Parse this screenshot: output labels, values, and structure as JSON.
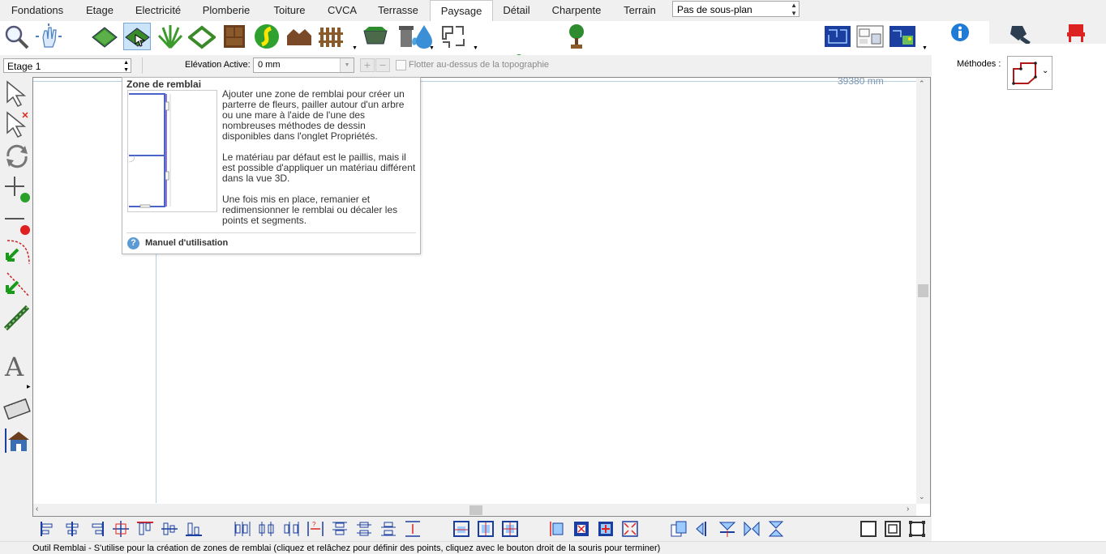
{
  "tabs": [
    {
      "label": "Fondations",
      "active": false
    },
    {
      "label": "Etage",
      "active": false
    },
    {
      "label": "Electricité",
      "active": false
    },
    {
      "label": "Plomberie",
      "active": false
    },
    {
      "label": "Toiture",
      "active": false
    },
    {
      "label": "CVCA",
      "active": false
    },
    {
      "label": "Terrasse",
      "active": false
    },
    {
      "label": "Paysage",
      "active": true
    },
    {
      "label": "Détail",
      "active": false
    },
    {
      "label": "Charpente",
      "active": false
    },
    {
      "label": "Terrain",
      "active": false
    }
  ],
  "subplan_select": {
    "value": "Pas de sous-plan"
  },
  "right_tabs": [
    "info-icon",
    "pen-nib-icon",
    "chair-icon"
  ],
  "toolbar": {
    "icons": [
      "zoom-icon",
      "pan-hand-icon",
      "lawn-icon",
      "fill-zone-icon",
      "grass-icon",
      "border-icon",
      "cabinet-icon",
      "path-icon",
      "shed-icon",
      "fence-icon",
      "planter-icon",
      "trash-bin-icon",
      "water-drop-icon",
      "shape-tool-icon",
      "tree-slider-icon",
      "tree-icon",
      "plan-view-icon",
      "layout-view-icon",
      "image-view-icon"
    ]
  },
  "floor_select": {
    "value": "Etage 1"
  },
  "elevation": {
    "label": "Elévation Active:",
    "value": "0 mm"
  },
  "float_checkbox": {
    "label": "Flotter au-dessus de la topographie",
    "checked": false
  },
  "canvas": {
    "ruler_label": "39380 mm"
  },
  "tooltip": {
    "title": "Zone de remblai",
    "paragraphs": [
      "Ajouter une zone de remblai pour créer un parterre de fleurs, pailler autour d'un arbre ou une mare à l'aide de l'une des nombreuses méthodes de dessin disponibles dans l'onglet Propriétés.",
      "Le matériau par défaut est le paillis, mais il est possible d'appliquer un matériau différent dans la vue 3D.",
      "Une fois mis en place, remanier et redimensionner le remblai ou décaler les points et segments."
    ],
    "help_link": "Manuel d'utilisation"
  },
  "right_panel": {
    "methods_label": "Méthodes :"
  },
  "status_bar": "Outil Remblai - S'utilise pour la création de zones de remblai (cliquez et relâchez pour définir des points, cliquez avec le bouton droit de la souris pour terminer)",
  "colors": {
    "accent": "#5b9bd5",
    "info_blue": "#1e7bd6",
    "red_tool": "#e02020",
    "green_tool": "#2aa02a"
  }
}
